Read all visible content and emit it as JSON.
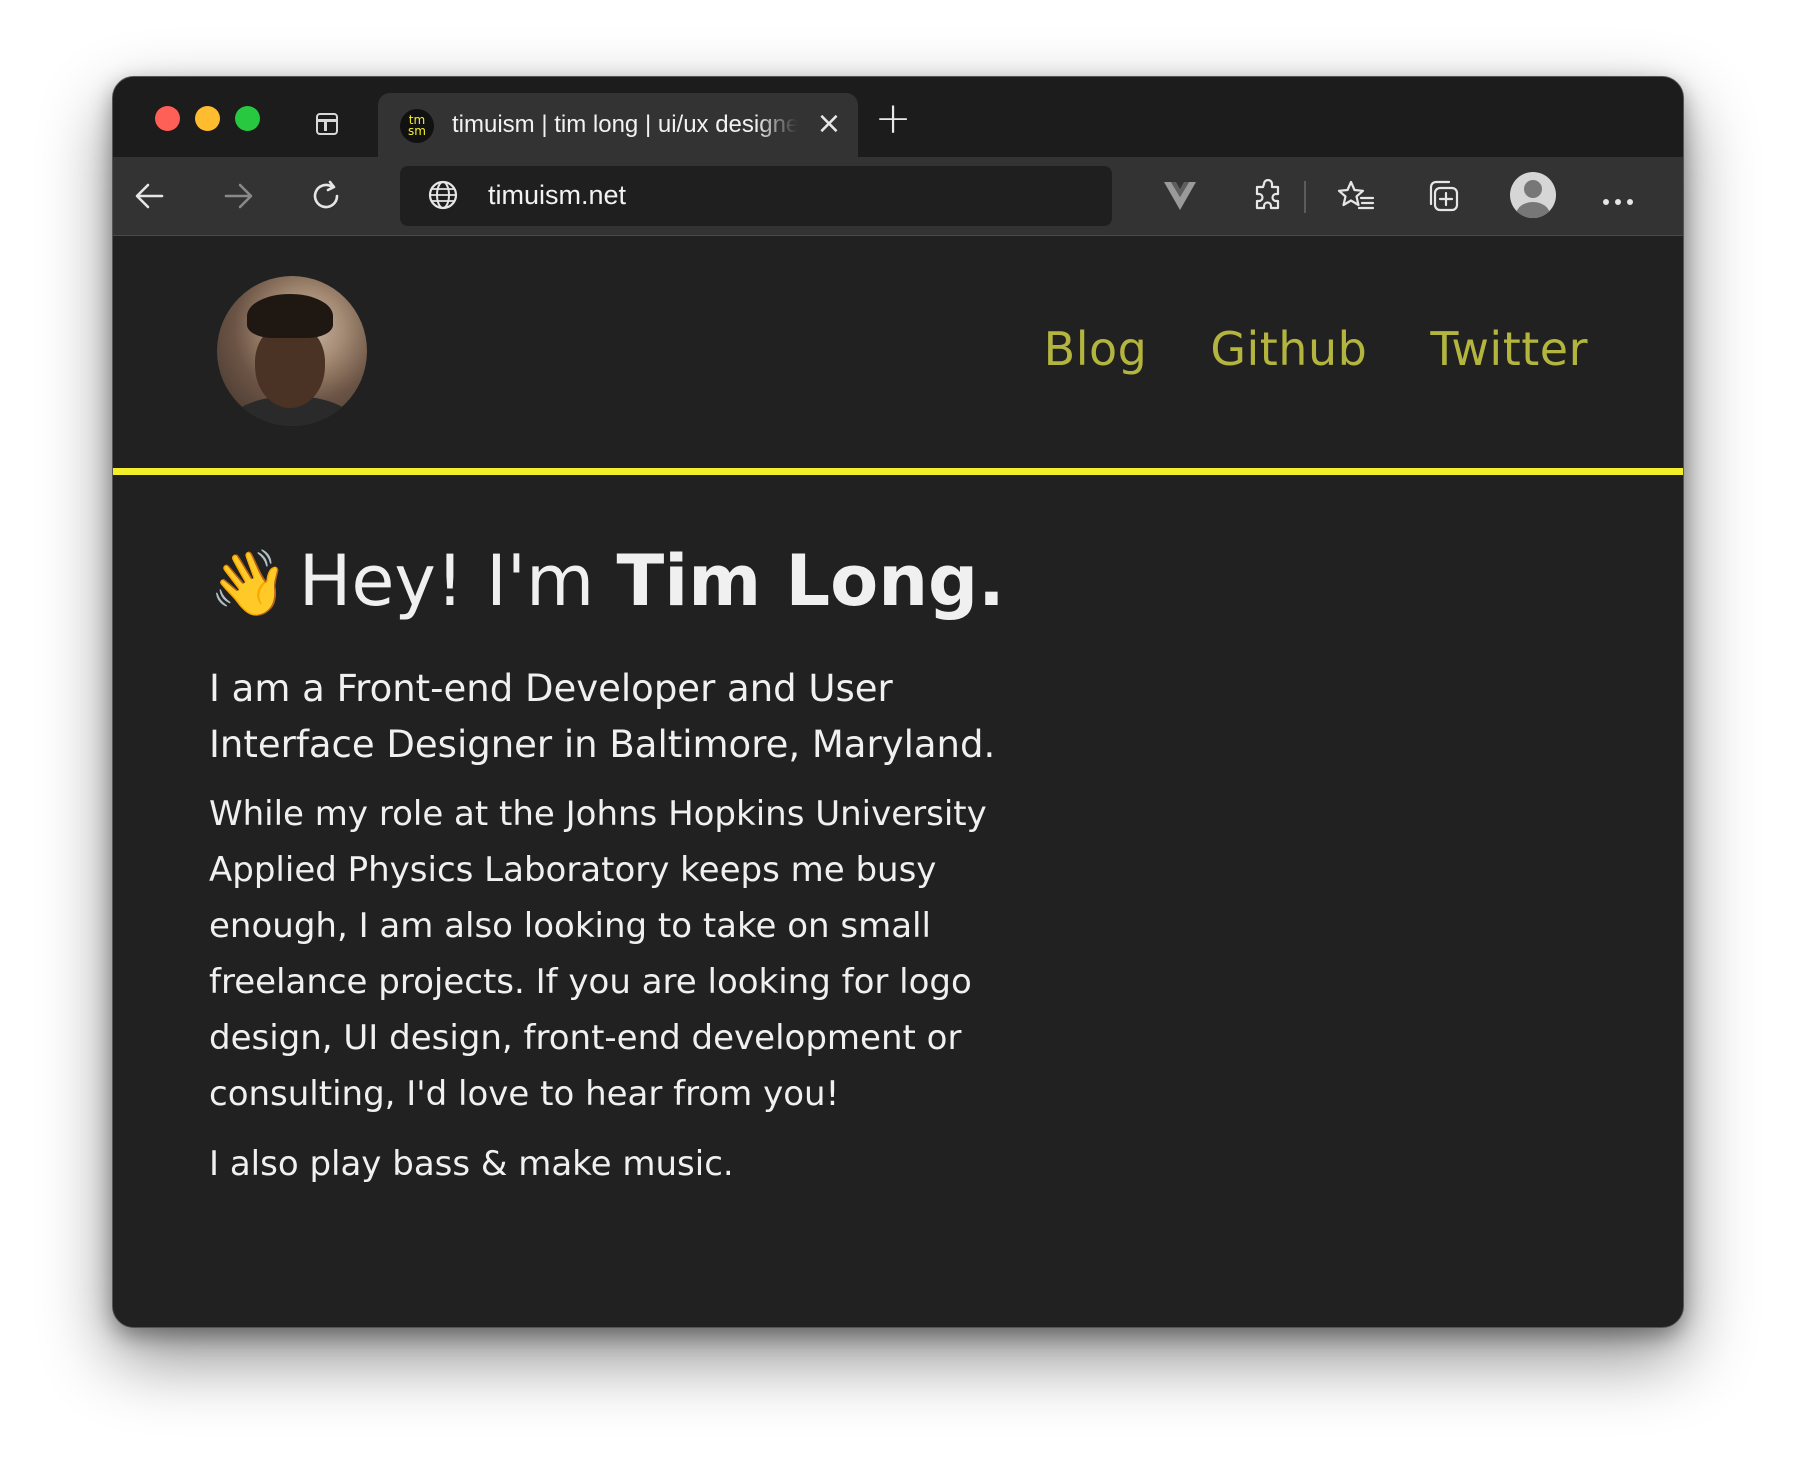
{
  "browser": {
    "tab": {
      "favicon_text": "tm sm",
      "title": "timuism | tim long | ui/ux designer"
    },
    "address": {
      "url": "timuism.net"
    },
    "icons": {
      "back": "arrow-left-icon",
      "forward": "arrow-right-icon",
      "reload": "reload-icon",
      "site_info": "globe-icon",
      "vue_devtools": "vue-logo-icon",
      "extensions": "puzzle-icon",
      "favorites": "star-list-icon",
      "collections": "collections-icon",
      "profile": "profile-icon",
      "more": "more-icon"
    }
  },
  "site": {
    "nav": {
      "blog": "Blog",
      "github": "Github",
      "twitter": "Twitter"
    },
    "colors": {
      "accent_line": "#f2ee2a",
      "nav_link": "#b4b53e",
      "background": "#212121"
    },
    "hero": {
      "wave": "👋",
      "greeting": "Hey! I'm ",
      "name": "Tim Long."
    },
    "lead": "I am a Front-end Developer and User Interface Designer in Baltimore, Maryland.",
    "paragraph": "While my role at the Johns Hopkins University Applied Physics Laboratory keeps me busy enough, I am also looking to take on small freelance projects. If you are looking for logo design, UI design, front-end development or consulting, I'd love to hear from you!",
    "music": "I also play bass & make music."
  }
}
